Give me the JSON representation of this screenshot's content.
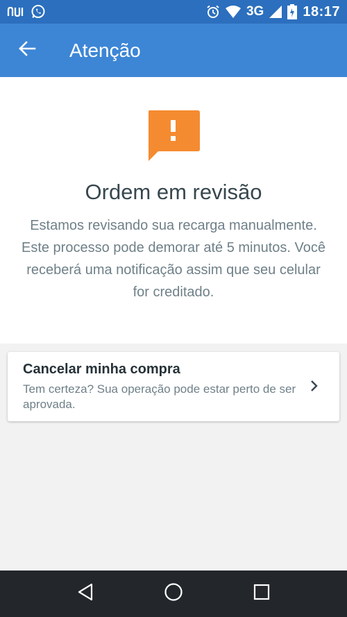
{
  "status_bar": {
    "network": "3G",
    "time": "18:17",
    "icons": [
      "nubank-icon",
      "whatsapp-icon",
      "alarm-icon",
      "wifi-icon",
      "signal-icon",
      "battery-icon"
    ]
  },
  "app_bar": {
    "title": "Atenção",
    "back_icon": "arrow-back-icon"
  },
  "hero": {
    "icon": "alert-message-icon",
    "title": "Ordem em revisão",
    "text": "Estamos revisando sua recarga manualmente. Este processo pode demorar até 5 minutos. Você receberá uma notificação assim que seu celular for creditado."
  },
  "cancel_card": {
    "title": "Cancelar minha compra",
    "subtitle": "Tem certeza? Sua operação pode estar perto de ser aprovada."
  },
  "nav_bar": {
    "buttons": [
      "back-triangle-icon",
      "home-circle-icon",
      "recents-square-icon"
    ]
  },
  "colors": {
    "status_bar": "#2b6fbe",
    "app_bar": "#3d86d6",
    "alert_icon": "#f58b31",
    "nav_bar": "#23272b"
  }
}
